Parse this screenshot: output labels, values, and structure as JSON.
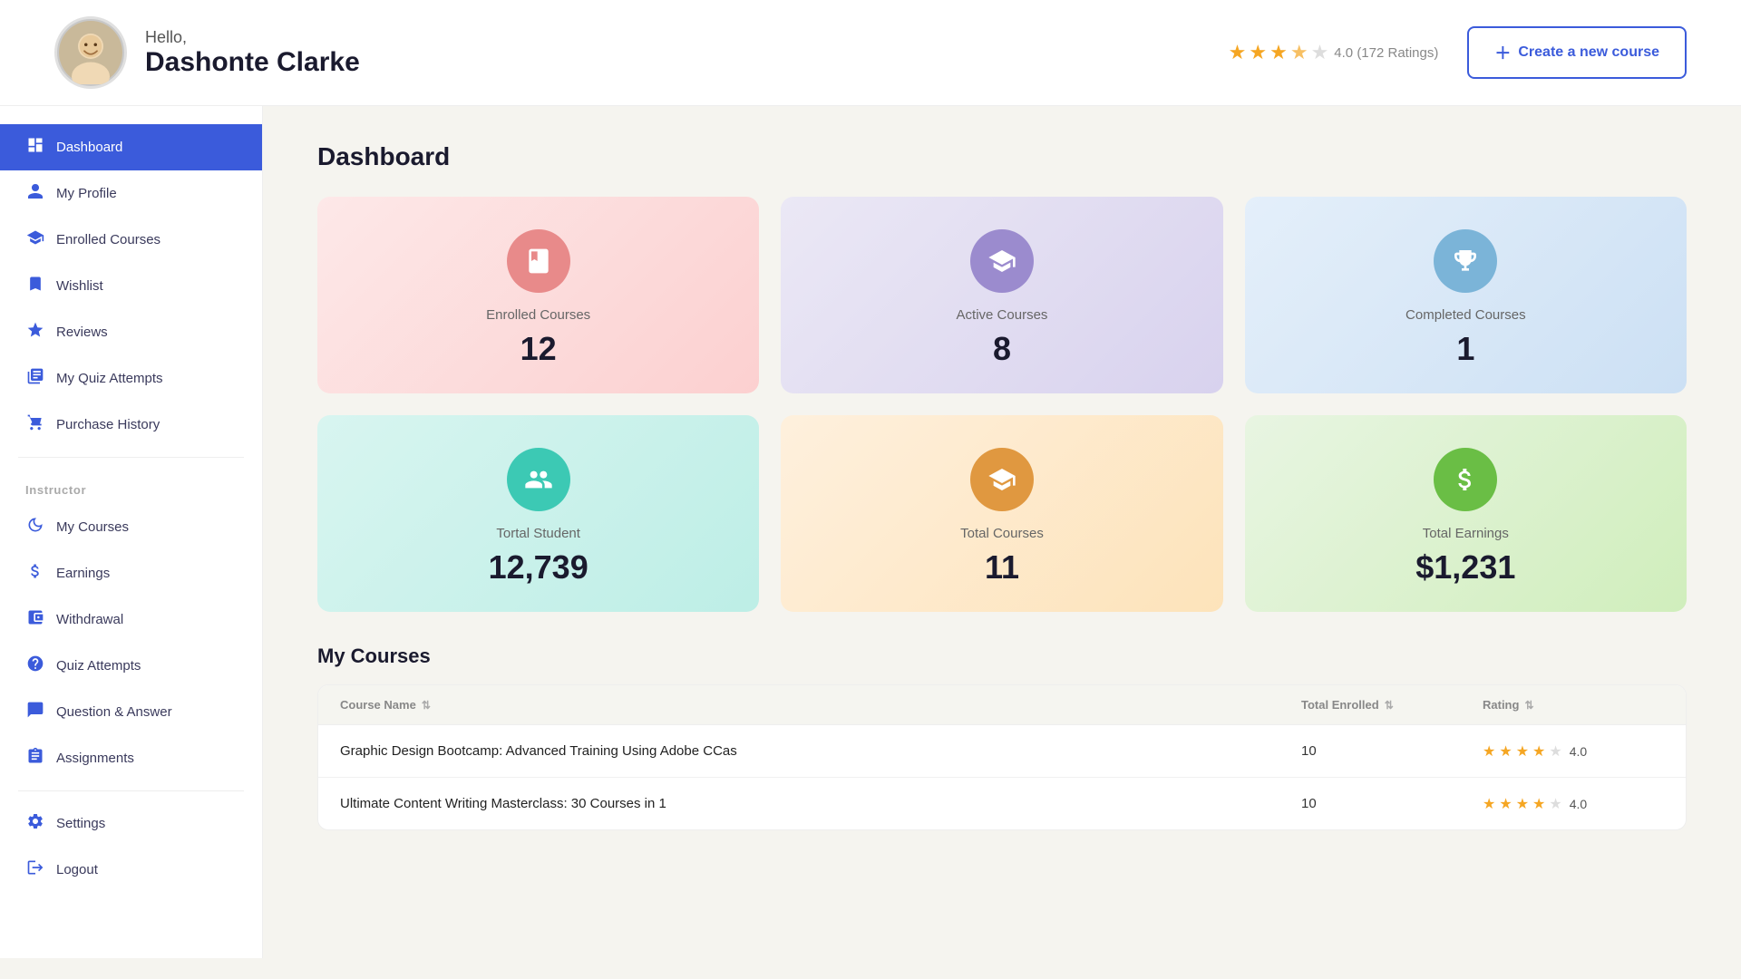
{
  "header": {
    "greeting": "Hello,",
    "user_name": "Dashonte Clarke",
    "rating_value": "4.0 (172 Ratings)",
    "create_btn_label": "Create a new course",
    "stars": [
      "filled",
      "filled",
      "filled",
      "half",
      "empty"
    ]
  },
  "sidebar": {
    "main_items": [
      {
        "id": "dashboard",
        "label": "Dashboard",
        "icon": "dashboard",
        "active": true
      },
      {
        "id": "my-profile",
        "label": "My Profile",
        "icon": "person"
      },
      {
        "id": "enrolled-courses",
        "label": "Enrolled Courses",
        "icon": "graduation"
      },
      {
        "id": "wishlist",
        "label": "Wishlist",
        "icon": "bookmark"
      },
      {
        "id": "reviews",
        "label": "Reviews",
        "icon": "star"
      },
      {
        "id": "quiz-attempts-student",
        "label": "My Quiz Attempts",
        "icon": "quiz"
      },
      {
        "id": "purchase-history",
        "label": "Purchase History",
        "icon": "cart"
      }
    ],
    "instructor_label": "Instructor",
    "instructor_items": [
      {
        "id": "my-courses",
        "label": "My Courses",
        "icon": "rocket"
      },
      {
        "id": "earnings",
        "label": "Earnings",
        "icon": "dollar"
      },
      {
        "id": "withdrawal",
        "label": "Withdrawal",
        "icon": "wallet"
      },
      {
        "id": "quiz-attempts",
        "label": "Quiz Attempts",
        "icon": "quiz2"
      },
      {
        "id": "question-answer",
        "label": "Question & Answer",
        "icon": "qa"
      },
      {
        "id": "assignments",
        "label": "Assignments",
        "icon": "assign"
      }
    ],
    "bottom_items": [
      {
        "id": "settings",
        "label": "Settings",
        "icon": "gear"
      },
      {
        "id": "logout",
        "label": "Logout",
        "icon": "logout"
      }
    ]
  },
  "main": {
    "page_title": "Dashboard",
    "stats": [
      {
        "id": "enrolled",
        "label": "Enrolled Courses",
        "value": "12",
        "color": "pink",
        "icon_color": "pink-ic"
      },
      {
        "id": "active",
        "label": "Active Courses",
        "value": "8",
        "color": "purple",
        "icon_color": "purple-ic"
      },
      {
        "id": "completed",
        "label": "Completed Courses",
        "value": "1",
        "color": "blue",
        "icon_color": "blue-ic"
      },
      {
        "id": "total-student",
        "label": "Tortal Student",
        "value": "12,739",
        "color": "teal",
        "icon_color": "teal-ic"
      },
      {
        "id": "total-courses",
        "label": "Total Courses",
        "value": "11",
        "color": "orange",
        "icon_color": "orange-ic"
      },
      {
        "id": "total-earnings",
        "label": "Total Earnings",
        "value": "$1,231",
        "color": "green",
        "icon_color": "green-ic"
      }
    ],
    "courses_section_title": "My Courses",
    "table_headers": [
      {
        "id": "course-name",
        "label": "Course Name",
        "sortable": true
      },
      {
        "id": "total-enrolled",
        "label": "Total Enrolled",
        "sortable": true
      },
      {
        "id": "rating",
        "label": "Rating",
        "sortable": true
      }
    ],
    "courses": [
      {
        "id": "course-1",
        "name": "Graphic Design Bootcamp: Advanced Training Using Adobe CCas",
        "enrolled": "10",
        "rating": 4.0,
        "stars": [
          "filled",
          "filled",
          "filled",
          "filled",
          "empty"
        ]
      },
      {
        "id": "course-2",
        "name": "Ultimate Content Writing Masterclass: 30 Courses in 1",
        "enrolled": "10",
        "rating": 4.0,
        "stars": [
          "filled",
          "filled",
          "filled",
          "filled",
          "empty"
        ]
      }
    ]
  }
}
